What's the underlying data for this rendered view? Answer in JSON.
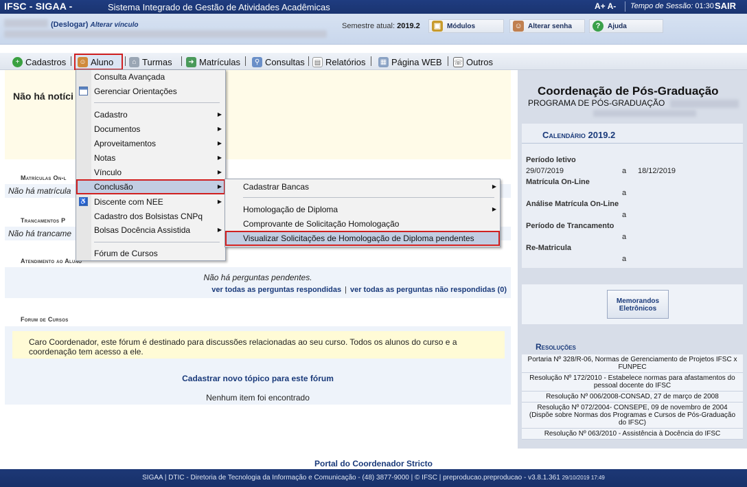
{
  "topbar": {
    "brand": "IFSC - SIGAA -",
    "full_name": "Sistema Integrado de Gestão de Atividades Acadêmicas",
    "font_controls": "A+ A-",
    "session_label": "Tempo de Sessão:",
    "session_time": "01:30",
    "logout": "SAIR"
  },
  "userbar": {
    "logout_link": "(Deslogar)",
    "change_link": "Alterar vínculo",
    "semester_label": "Semestre atual:",
    "semester_value": "2019.2",
    "buttons": [
      "Módulos",
      "Alterar senha",
      "Ajuda"
    ]
  },
  "menubar": {
    "items": [
      "Cadastros",
      "Aluno",
      "Turmas",
      "Matrículas",
      "Consultas",
      "Relatórios",
      "Página WEB",
      "Outros"
    ]
  },
  "aluno_menu": {
    "items": [
      "Consulta Avançada",
      "Gerenciar Orientações",
      "Cadastro",
      "Documentos",
      "Aproveitamentos",
      "Notas",
      "Vínculo",
      "Conclusão",
      "Discente com NEE",
      "Cadastro dos Bolsistas CNPq",
      "Bolsas Docência Assistida",
      "Fórum de Cursos"
    ]
  },
  "conclusao_menu": {
    "items": [
      "Cadastrar Bancas",
      "Homologação de Diploma",
      "Comprovante de Solicitação Homologação",
      "Visualizar Solicitações de Homologação de Diploma pendentes"
    ]
  },
  "main": {
    "news_title": "Não há notíci",
    "matriculas_title": "Matrículas On-l",
    "matriculas_empty": "Não há matrícula",
    "trancamentos_title": "Trancamentos P",
    "trancamentos_empty": "Não há trancame",
    "atendimento_title": "Atendimento ao Aluno",
    "no_questions": "Não há perguntas pendentes.",
    "link_answered": "ver todas as perguntas respondidas",
    "link_unanswered": "ver todas as perguntas não respondidas (0)",
    "forum_title": "Forum de Cursos",
    "forum_note": "Caro Coordenador, este fórum é destinado para discussões relacionadas ao seu curso. Todos os alunos do curso e a coordenação tem acesso a ele.",
    "forum_new_topic": "Cadastrar novo tópico para este fórum",
    "forum_none": "Nenhum item foi encontrado"
  },
  "right": {
    "coord_title": "Coordenação de Pós-Graduação",
    "program": "PROGRAMA DE PÓS-GRADUAÇÃO",
    "calendar_title": "Calendário 2019.2",
    "periodo_label": "Período letivo",
    "periodo_start": "29/07/2019",
    "periodo_a": "a",
    "periodo_end": "18/12/2019",
    "matricula_label": "Matrícula On-Line",
    "matricula_a": "a",
    "analise_label": "Análise Matrícula On-Line",
    "analise_a": "a",
    "trancamento_label": "Período de Trancamento",
    "trancamento_a": "a",
    "rematricula_label": "Re-Matricula",
    "rematricula_a": "a",
    "memorandos_line1": "Memorandos",
    "memorandos_line2": "Eletrônicos",
    "resolucoes_title": "Resoluções",
    "resolucoes": [
      "Portaria Nº 328/R-06, Normas de Gerenciamento de Projetos IFSC x FUNPEC",
      "Resolução Nº 172/2010 - Estabelece normas para afastamentos do pessoal docente do IFSC",
      "Resolução Nº 006/2008-CONSAD, 27 de março de 2008",
      "Resolução Nº 072/2004- CONSEPE, 09 de novembro de 2004 (Dispõe sobre Normas dos Programas e Cursos de Pós-Graduação do IFSC)",
      "Resolução Nº 063/2010 - Assistência à Docência do IFSC"
    ]
  },
  "footer": {
    "portal": "Portal do Coordenador Stricto",
    "text": "SIGAA | DTIC - Diretoria de Tecnologia da Informação e Comunicação - (48) 3877-9000 | © IFSC | preproducao.preproducao - v3.8.1.361",
    "timestamp": "29/10/2019 17:49"
  },
  "colors": {
    "header_blue": "#1f3c80",
    "highlight_red": "#d01f1f",
    "link_blue": "#1a3a7a"
  }
}
